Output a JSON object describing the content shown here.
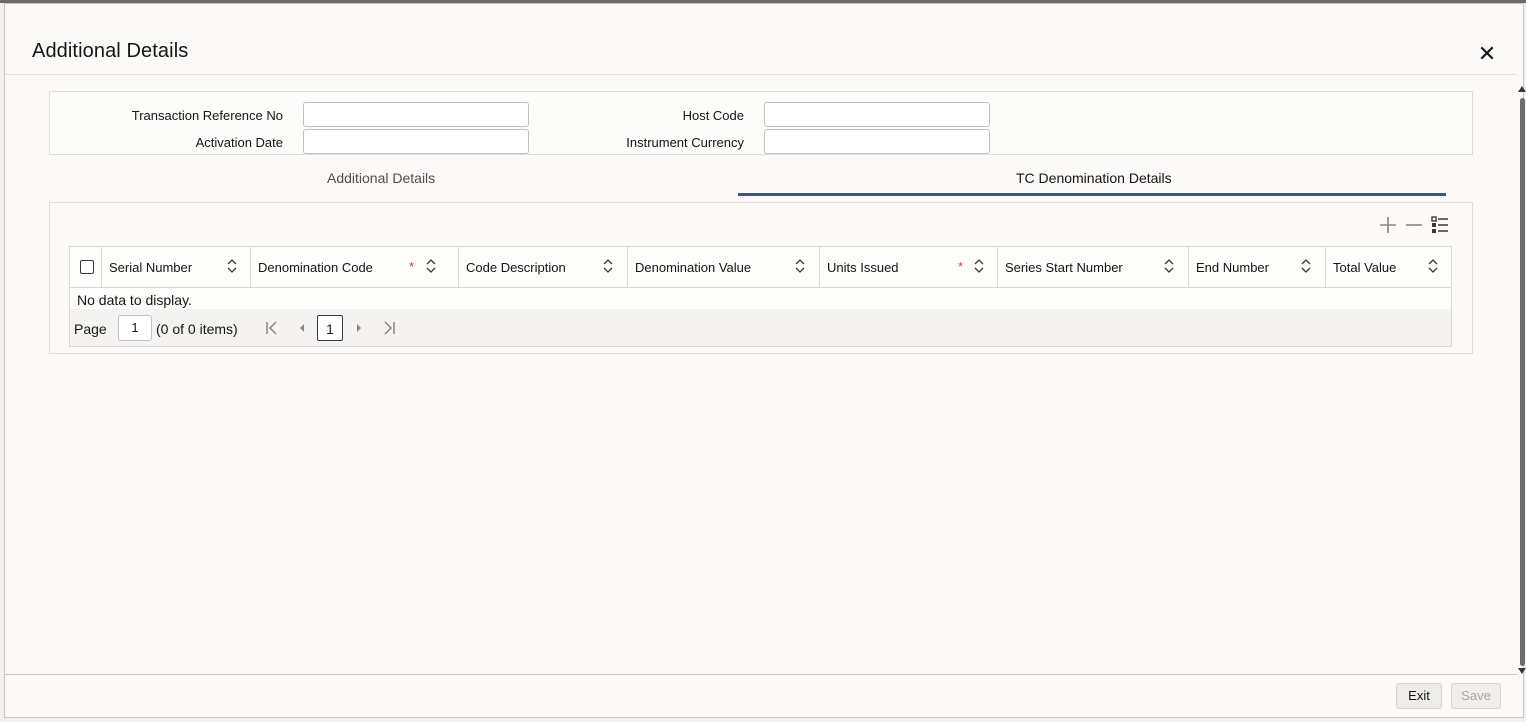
{
  "dialog": {
    "title": "Additional Details",
    "close_icon": "close-icon"
  },
  "header_fields": {
    "txn_ref_label": "Transaction Reference No",
    "txn_ref_value": "",
    "host_code_label": "Host Code",
    "host_code_value": "",
    "activation_date_label": "Activation Date",
    "activation_date_value": "",
    "instrument_currency_label": "Instrument Currency",
    "instrument_currency_value": ""
  },
  "tabs": [
    {
      "label": "Additional Details",
      "active": false
    },
    {
      "label": "TC Denomination Details",
      "active": true
    }
  ],
  "toolbar": {
    "add_icon": "plus-icon",
    "remove_icon": "minus-icon",
    "columns_icon": "column-list-icon"
  },
  "table": {
    "columns": [
      {
        "label": "Serial Number",
        "required": false
      },
      {
        "label": "Denomination Code",
        "required": true
      },
      {
        "label": "Code Description",
        "required": false
      },
      {
        "label": "Denomination Value",
        "required": false
      },
      {
        "label": "Units Issued",
        "required": true
      },
      {
        "label": "Series Start Number",
        "required": false
      },
      {
        "label": "End Number",
        "required": false
      },
      {
        "label": "Total Value",
        "required": false
      }
    ],
    "required_marker": "*",
    "rows": [],
    "empty_text": "No data to display."
  },
  "pagination": {
    "page_label": "Page",
    "page_value": "1",
    "count_text": "(0 of 0 items)",
    "current_page": "1"
  },
  "footer": {
    "exit_label": "Exit",
    "save_label": "Save"
  },
  "colors": {
    "accent_underline": "#3b5876",
    "required": "#c74634"
  }
}
